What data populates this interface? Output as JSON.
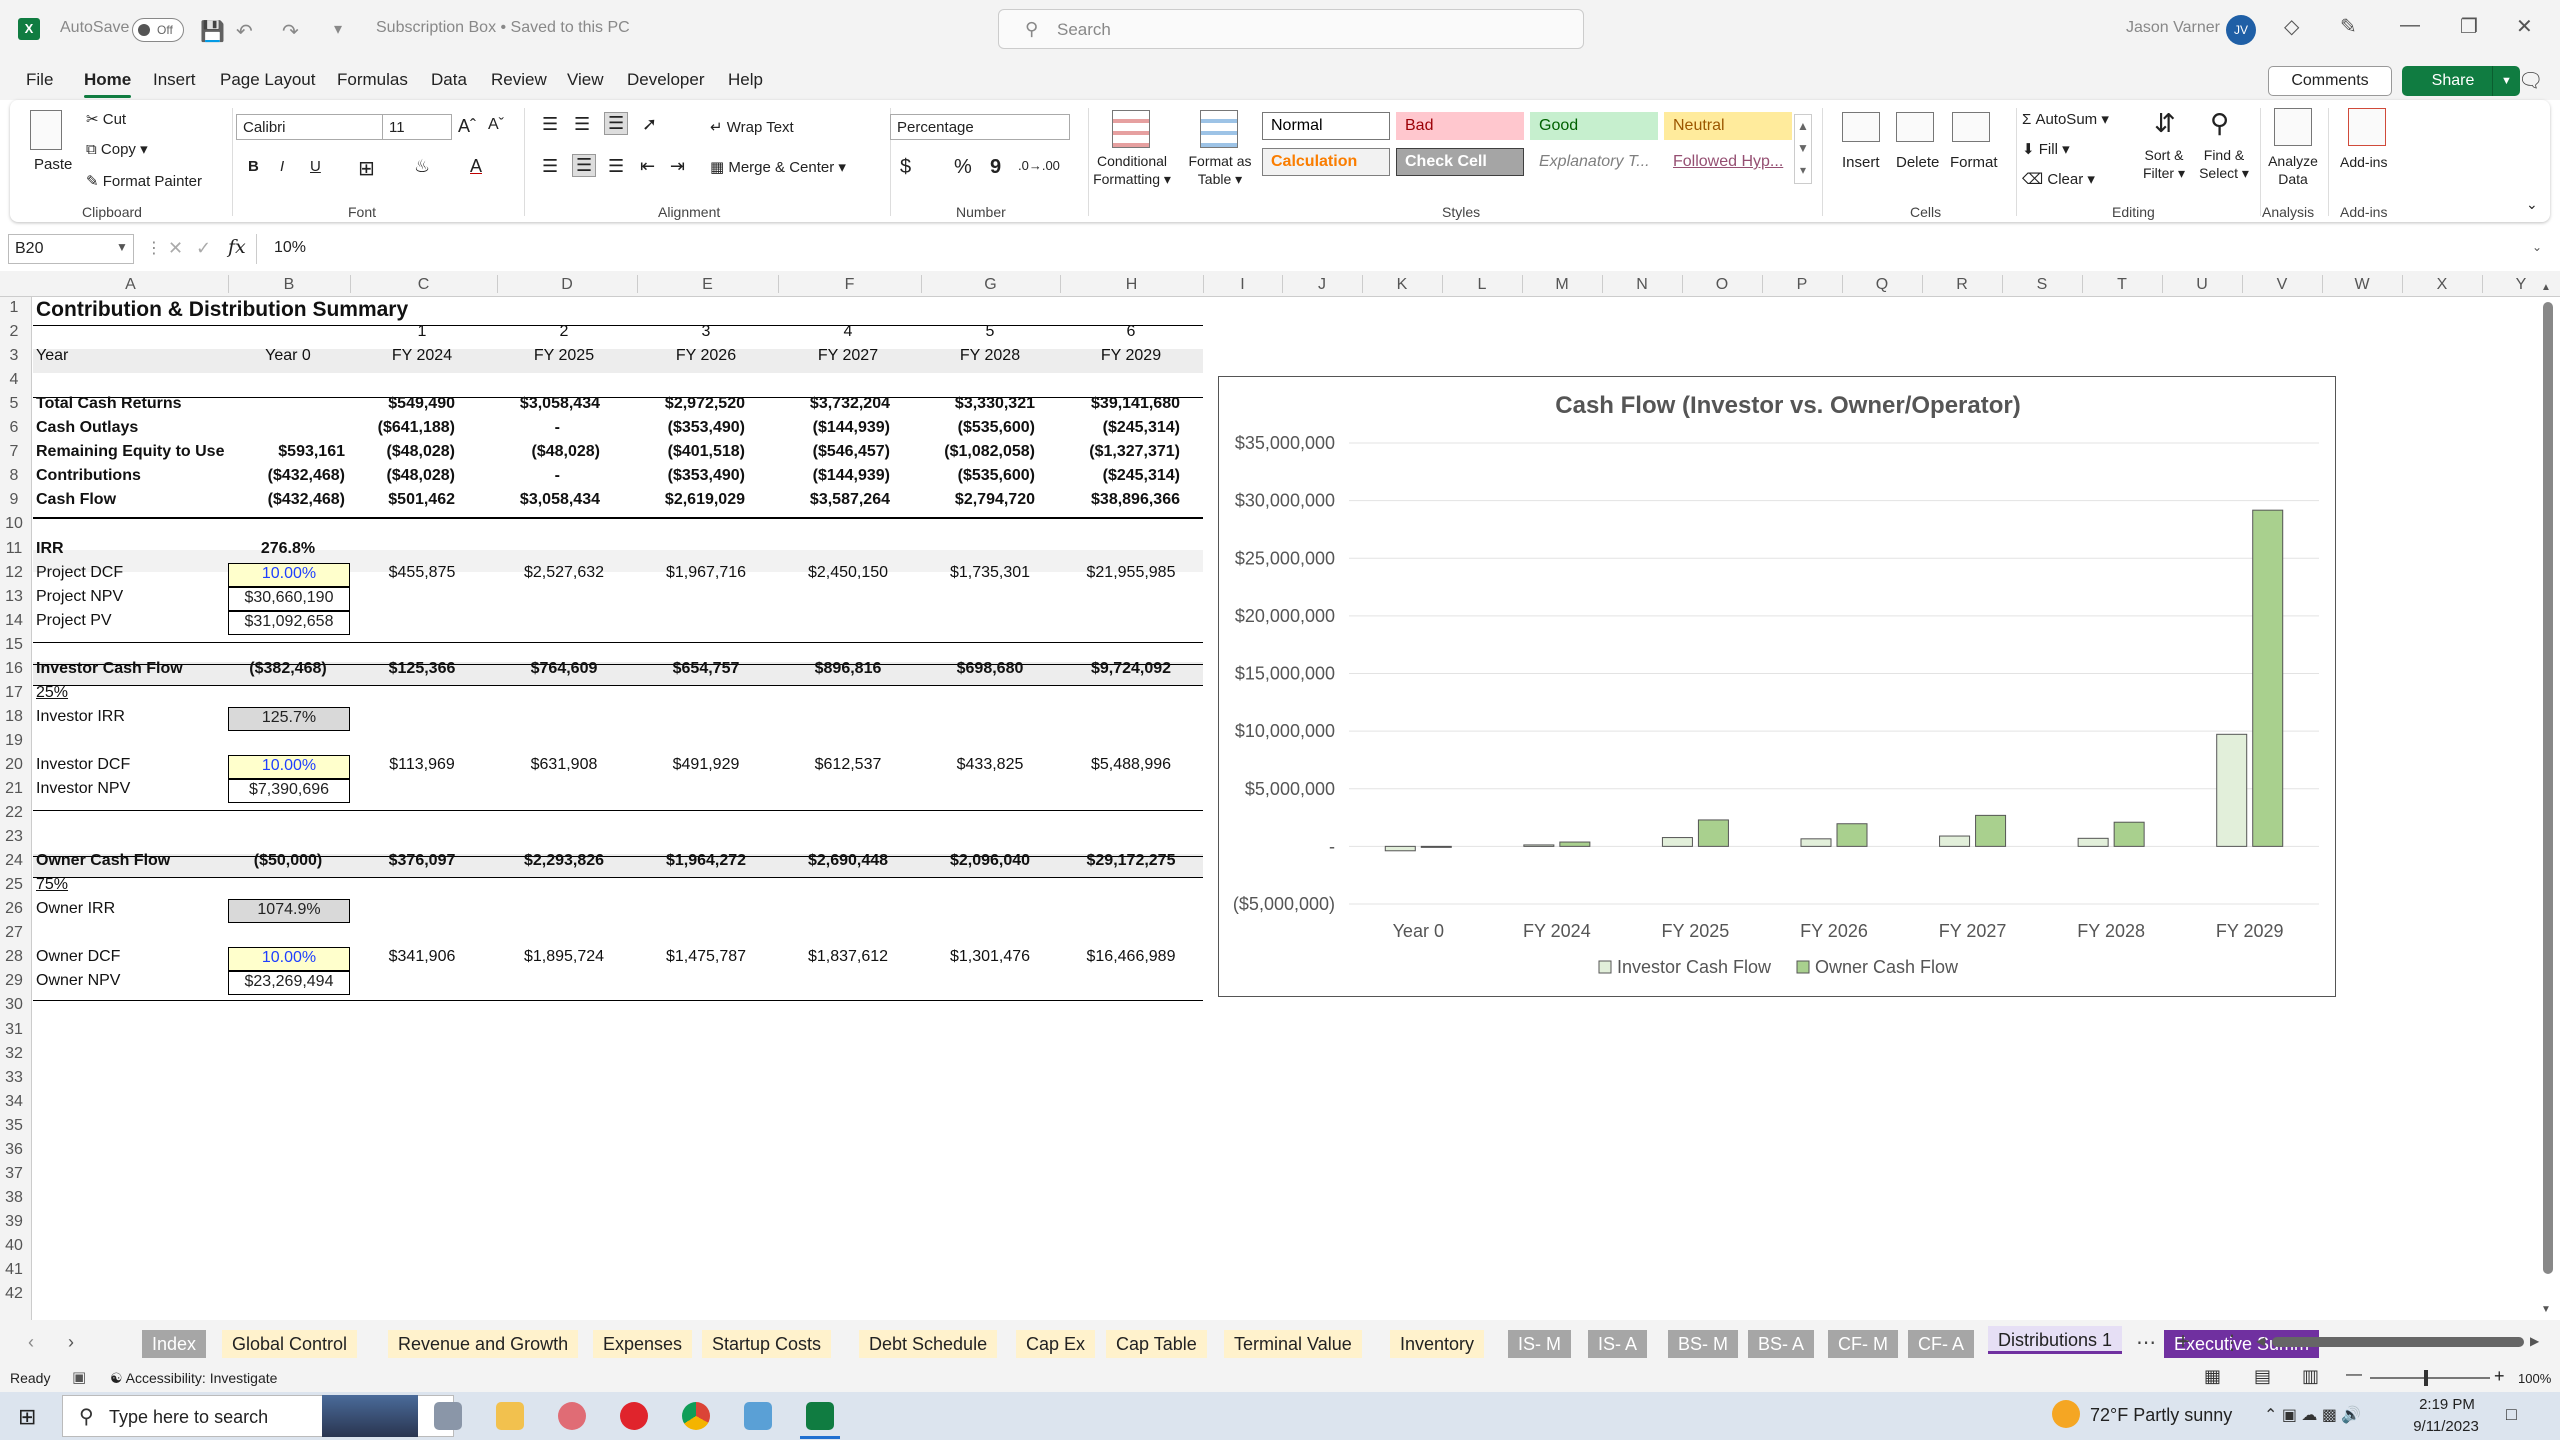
{
  "titlebar": {
    "autosave_label": "AutoSave",
    "autosave_state": "Off",
    "doc_title": "Subscription Box • Saved to this PC",
    "search_placeholder": "Search",
    "user_name": "Jason Varner",
    "user_initials": "JV",
    "app_letter": "X"
  },
  "menu": [
    "File",
    "Home",
    "Insert",
    "Page Layout",
    "Formulas",
    "Data",
    "Review",
    "View",
    "Developer",
    "Help"
  ],
  "menu_active": "Home",
  "header_buttons": {
    "comments": "Comments",
    "share": "Share"
  },
  "ribbon": {
    "clipboard": {
      "paste": "Paste",
      "cut": "Cut",
      "copy": "Copy",
      "format_painter": "Format Painter",
      "group": "Clipboard"
    },
    "font": {
      "name": "Calibri",
      "size": "11",
      "group": "Font",
      "bold": "B",
      "italic": "I",
      "underline": "U"
    },
    "alignment": {
      "wrap": "Wrap Text",
      "merge": "Merge & Center",
      "group": "Alignment"
    },
    "number": {
      "format": "Percentage",
      "currency": "$",
      "percent": "%",
      "comma": "9",
      "group": "Number"
    },
    "styles": {
      "conditional": [
        "Conditional",
        "Formatting"
      ],
      "format_table": [
        "Format as",
        "Table"
      ],
      "group": "Styles",
      "cells": [
        {
          "label": "Normal",
          "bg": "#ffffff",
          "fg": "#000000",
          "border": "#777777"
        },
        {
          "label": "Bad",
          "bg": "#ffc7ce",
          "fg": "#9c0006",
          "border": "#ffc7ce"
        },
        {
          "label": "Good",
          "bg": "#c6efce",
          "fg": "#006100",
          "border": "#c6efce"
        },
        {
          "label": "Neutral",
          "bg": "#ffeb9c",
          "fg": "#9c5700",
          "border": "#ffeb9c"
        },
        {
          "label": "Calculation",
          "bg": "#f2f2f2",
          "fg": "#fa7d00",
          "border": "#7f7f7f"
        },
        {
          "label": "Check Cell",
          "bg": "#a5a5a5",
          "fg": "#ffffff",
          "border": "#3f3f3f"
        },
        {
          "label": "Explanatory T...",
          "bg": "#ffffff",
          "fg": "#7f7f7f",
          "border": "#ffffff"
        },
        {
          "label": "Followed Hyp...",
          "bg": "#ffffff",
          "fg": "#954f72",
          "border": "#ffffff"
        }
      ]
    },
    "cells": {
      "insert": "Insert",
      "delete": "Delete",
      "format": "Format",
      "group": "Cells"
    },
    "editing": {
      "autosum": "AutoSum",
      "fill": "Fill",
      "clear": "Clear",
      "sort": [
        "Sort &",
        "Filter"
      ],
      "find": [
        "Find &",
        "Select"
      ],
      "group": "Editing"
    },
    "analysis": {
      "analyze": [
        "Analyze",
        "Data"
      ],
      "group": "Analysis"
    },
    "addins": {
      "label": "Add-ins",
      "group": "Add-ins"
    }
  },
  "formula_bar": {
    "name_box": "B20",
    "fx": "fx",
    "value": "10%"
  },
  "columns": [
    "A",
    "B",
    "C",
    "D",
    "E",
    "F",
    "G",
    "H",
    "I",
    "J",
    "K",
    "L",
    "M",
    "N",
    "O",
    "P",
    "Q",
    "R",
    "S",
    "T",
    "U",
    "V",
    "W",
    "X",
    "Y"
  ],
  "rows": [
    "1",
    "2",
    "3",
    "4",
    "5",
    "6",
    "7",
    "8",
    "9",
    "10",
    "11",
    "12",
    "13",
    "14",
    "15",
    "16",
    "17",
    "18",
    "19",
    "20",
    "21",
    "22",
    "23",
    "24",
    "25",
    "26",
    "27",
    "28",
    "29",
    "30",
    "31",
    "32",
    "33",
    "34",
    "35",
    "36",
    "37",
    "38",
    "39",
    "40",
    "41",
    "42"
  ],
  "sheet": {
    "title": "Contribution & Distribution Summary",
    "period_numbers": [
      "1",
      "2",
      "3",
      "4",
      "5",
      "6"
    ],
    "year_label": "Year",
    "years": [
      "Year 0",
      "FY 2024",
      "FY 2025",
      "FY 2026",
      "FY 2027",
      "FY 2028",
      "FY 2029"
    ],
    "block1": [
      {
        "label": "Total Cash Returns",
        "bold": true,
        "vals": [
          "",
          "$549,490",
          "$3,058,434",
          "$2,972,520",
          "$3,732,204",
          "$3,330,321",
          "$39,141,680"
        ]
      },
      {
        "label": "Cash Outlays",
        "bold": true,
        "vals": [
          "",
          "($641,188)",
          "-",
          "($353,490)",
          "($144,939)",
          "($535,600)",
          "($245,314)"
        ]
      },
      {
        "label": "Remaining Equity to Use",
        "bold": true,
        "vals": [
          "$593,161",
          "($48,028)",
          "($48,028)",
          "($401,518)",
          "($546,457)",
          "($1,082,058)",
          "($1,327,371)"
        ]
      },
      {
        "label": "Contributions",
        "bold": true,
        "vals": [
          "($432,468)",
          "($48,028)",
          "-",
          "($353,490)",
          "($144,939)",
          "($535,600)",
          "($245,314)"
        ]
      },
      {
        "label": "Cash Flow",
        "bold": true,
        "vals": [
          "($432,468)",
          "$501,462",
          "$3,058,434",
          "$2,619,029",
          "$3,587,264",
          "$2,794,720",
          "$38,896,366"
        ]
      }
    ],
    "irr": {
      "label": "IRR",
      "value": "276.8%"
    },
    "project_dcf": {
      "label": "Project DCF",
      "rate": "10.00%",
      "vals": [
        "$455,875",
        "$2,527,632",
        "$1,967,716",
        "$2,450,150",
        "$1,735,301",
        "$21,955,985"
      ]
    },
    "project_npv": {
      "label": "Project NPV",
      "value": "$30,660,190"
    },
    "project_pv": {
      "label": "Project PV",
      "value": "$31,092,658"
    },
    "investor_cf": {
      "label": "Investor Cash Flow",
      "vals": [
        "($382,468)",
        "$125,366",
        "$764,609",
        "$654,757",
        "$896,816",
        "$698,680",
        "$9,724,092"
      ]
    },
    "investor_share": "25%",
    "investor_irr": {
      "label": "Investor IRR",
      "value": "125.7%"
    },
    "investor_dcf": {
      "label": "Investor DCF",
      "rate": "10.00%",
      "vals": [
        "$113,969",
        "$631,908",
        "$491,929",
        "$612,537",
        "$433,825",
        "$5,488,996"
      ]
    },
    "investor_npv": {
      "label": "Investor NPV",
      "value": "$7,390,696"
    },
    "owner_cf": {
      "label": "Owner Cash Flow",
      "vals": [
        "($50,000)",
        "$376,097",
        "$2,293,826",
        "$1,964,272",
        "$2,690,448",
        "$2,096,040",
        "$29,172,275"
      ]
    },
    "owner_share": "75%",
    "owner_irr": {
      "label": "Owner IRR",
      "value": "1074.9%"
    },
    "owner_dcf": {
      "label": "Owner DCF",
      "rate": "10.00%",
      "vals": [
        "$341,906",
        "$1,895,724",
        "$1,475,787",
        "$1,837,612",
        "$1,301,476",
        "$16,466,989"
      ]
    },
    "owner_npv": {
      "label": "Owner NPV",
      "value": "$23,269,494"
    }
  },
  "chart_data": {
    "type": "bar",
    "title": "Cash Flow (Investor vs. Owner/Operator)",
    "categories": [
      "Year 0",
      "FY 2024",
      "FY 2025",
      "FY 2026",
      "FY 2027",
      "FY 2028",
      "FY 2029"
    ],
    "series": [
      {
        "name": "Investor Cash Flow",
        "color": "#e2efda",
        "values": [
          -382468,
          125366,
          764609,
          654757,
          896816,
          698680,
          9724092
        ]
      },
      {
        "name": "Owner Cash Flow",
        "color": "#a9d08e",
        "values": [
          -50000,
          376097,
          2293826,
          1964272,
          2690448,
          2096040,
          29172275
        ]
      }
    ],
    "ylim": [
      -5000000,
      35000000
    ],
    "yticks": [
      35000000,
      30000000,
      25000000,
      20000000,
      15000000,
      10000000,
      5000000,
      0,
      -5000000
    ],
    "ytick_labels": [
      "$35,000,000",
      "$30,000,000",
      "$25,000,000",
      "$20,000,000",
      "$15,000,000",
      "$10,000,000",
      "$5,000,000",
      "-",
      "($5,000,000)"
    ],
    "grid": true,
    "legend": "bottom"
  },
  "tabs": [
    {
      "label": "Index",
      "bg": "#a6a6a6",
      "fg": "#ffffff"
    },
    {
      "label": "Global Control",
      "bg": "#fff2cc",
      "fg": "#222222"
    },
    {
      "label": "Revenue and Growth",
      "bg": "#fff2cc",
      "fg": "#222222"
    },
    {
      "label": "Expenses",
      "bg": "#fff2cc",
      "fg": "#222222"
    },
    {
      "label": "Startup Costs",
      "bg": "#fff2cc",
      "fg": "#222222"
    },
    {
      "label": "Debt Schedule",
      "bg": "#fff2cc",
      "fg": "#222222"
    },
    {
      "label": "Cap Ex",
      "bg": "#fff2cc",
      "fg": "#222222"
    },
    {
      "label": "Cap Table",
      "bg": "#fff2cc",
      "fg": "#222222"
    },
    {
      "label": "Terminal Value",
      "bg": "#fff2cc",
      "fg": "#222222"
    },
    {
      "label": "Inventory",
      "bg": "#fff2cc",
      "fg": "#222222"
    },
    {
      "label": "IS- M",
      "bg": "#a6a6a6",
      "fg": "#ffffff"
    },
    {
      "label": "IS- A",
      "bg": "#a6a6a6",
      "fg": "#ffffff"
    },
    {
      "label": "BS- M",
      "bg": "#a6a6a6",
      "fg": "#ffffff"
    },
    {
      "label": "BS- A",
      "bg": "#a6a6a6",
      "fg": "#ffffff"
    },
    {
      "label": "CF- M",
      "bg": "#a6a6a6",
      "fg": "#ffffff"
    },
    {
      "label": "CF- A",
      "bg": "#a6a6a6",
      "fg": "#ffffff"
    },
    {
      "label": "Distributions 1",
      "bg": "#e6dff5",
      "fg": "#222222",
      "active": true
    },
    {
      "label": "Executive Summ",
      "bg": "#7030a0",
      "fg": "#ffffff"
    }
  ],
  "status": {
    "ready": "Ready",
    "accessibility": "Accessibility: Investigate",
    "zoom": "100%"
  },
  "taskbar": {
    "search_placeholder": "Type here to search",
    "weather": "72°F  Partly sunny",
    "time": "2:19 PM",
    "date": "9/11/2023"
  }
}
